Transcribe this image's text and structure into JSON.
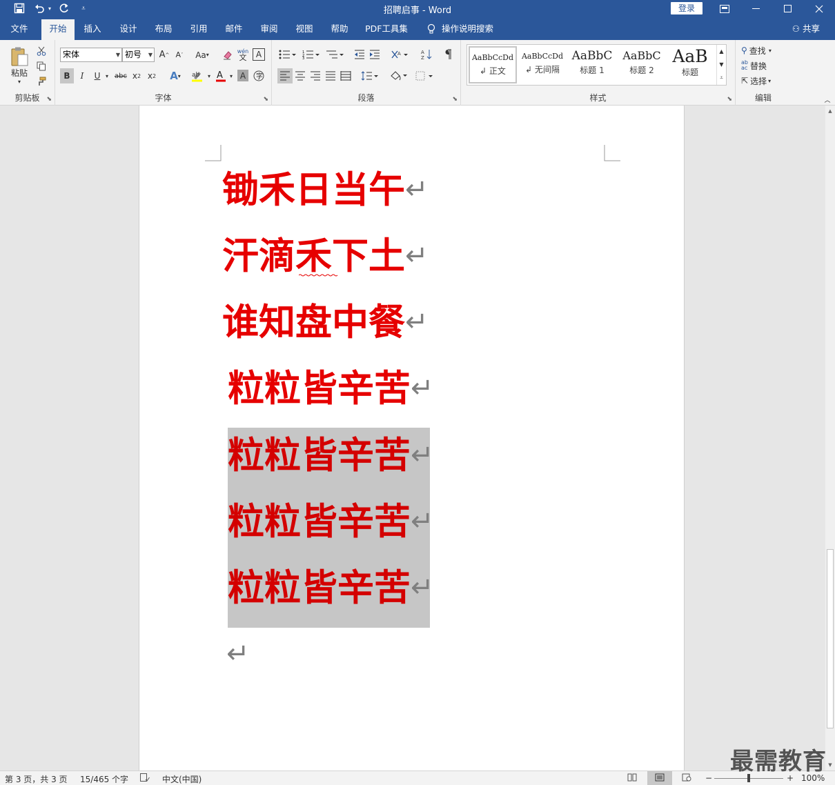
{
  "window": {
    "title": "招聘启事  -  Word",
    "login_label": "登录"
  },
  "tabs": [
    "文件",
    "开始",
    "插入",
    "设计",
    "布局",
    "引用",
    "邮件",
    "审阅",
    "视图",
    "帮助",
    "PDF工具集"
  ],
  "tell_me": "操作说明搜索",
  "share_label": "共享",
  "ribbon": {
    "clipboard": {
      "paste_label": "粘贴",
      "group_label": "剪贴板"
    },
    "font": {
      "font_name": "宋体",
      "font_size": "初号",
      "group_label": "字体",
      "aa_label": "Aa",
      "wen_label": "wén"
    },
    "paragraph": {
      "group_label": "段落"
    },
    "styles": {
      "group_label": "样式",
      "items": [
        {
          "preview": "AaBbCcDd",
          "name": "正文"
        },
        {
          "preview": "AaBbCcDd",
          "name": "无间隔"
        },
        {
          "preview": "AaBbC",
          "name": "标题 1"
        },
        {
          "preview": "AaBbC",
          "name": "标题 2"
        },
        {
          "preview": "AaB",
          "name": "标题"
        }
      ]
    },
    "editing": {
      "find_label": "查找",
      "replace_label": "替换",
      "select_label": "选择",
      "group_label": "编辑"
    }
  },
  "document": {
    "lines": [
      "锄禾日当午",
      "汗滴禾下土",
      "谁知盘中餐",
      "粒粒皆辛苦",
      "粒粒皆辛苦",
      "粒粒皆辛苦",
      "粒粒皆辛苦"
    ],
    "text_color": "#e60000",
    "highlight_color": "#c6c6c6",
    "paragraph_mark": "↵"
  },
  "status": {
    "page": "第 3 页，共 3 页",
    "words": "15/465 个字",
    "language": "中文(中国)",
    "zoom": "100%",
    "zoom_minus": "−",
    "zoom_plus": "+"
  },
  "watermark": "最需教育",
  "colors": {
    "titlebar": "#2b579a",
    "ribbon": "#f3f3f3",
    "font_red": "#e60000",
    "highlight_yellow": "#ffff00"
  }
}
